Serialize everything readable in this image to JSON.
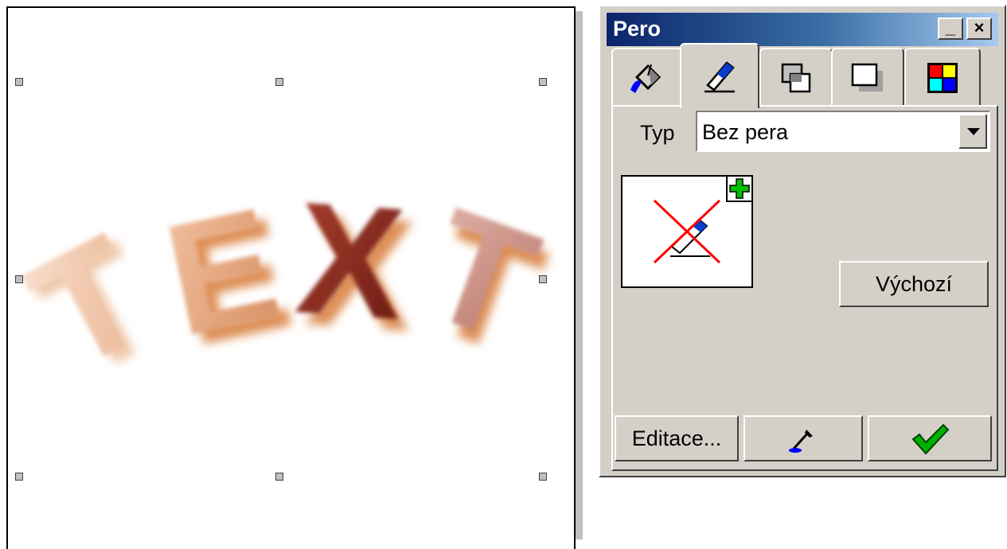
{
  "canvas": {
    "art_text": [
      "T",
      "E",
      "X",
      "T"
    ],
    "colors": {
      "T1": "#f0c8b0",
      "E": "#e8a878",
      "X": "#8b2a1e",
      "T2": "#c89088",
      "shadow": "#d2691e"
    }
  },
  "dialog": {
    "title": "Pero",
    "minimize_label": "_",
    "close_label": "×",
    "tabs": [
      {
        "icon": "fill-bucket-icon"
      },
      {
        "icon": "pen-icon",
        "active": true
      },
      {
        "icon": "transparency-icon"
      },
      {
        "icon": "shadow-icon"
      },
      {
        "icon": "color-palette-icon"
      }
    ],
    "type_label": "Typ",
    "type_value": "Bez pera",
    "default_button": "Výchozí",
    "edit_button": "Editace...",
    "eyedropper_icon": "eyedropper-icon",
    "apply_icon": "checkmark-icon"
  }
}
